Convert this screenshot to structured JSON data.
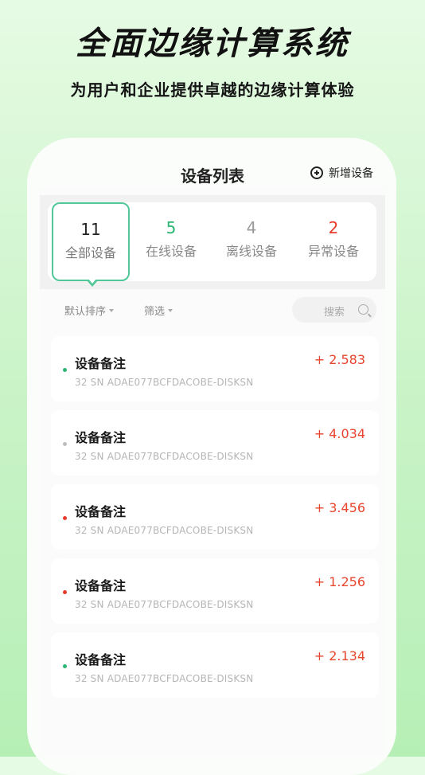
{
  "promo": {
    "title": "全面边缘计算系统",
    "subtitle": "为用户和企业提供卓越的边缘计算体验"
  },
  "topbar": {
    "title": "设备列表",
    "add_label": "新增设备"
  },
  "stats": [
    {
      "count": "11",
      "label": "全部设备",
      "color": "#222222",
      "active": true
    },
    {
      "count": "5",
      "label": "在线设备",
      "color": "#2bb673",
      "active": false
    },
    {
      "count": "4",
      "label": "离线设备",
      "color": "#9a9a9a",
      "active": false
    },
    {
      "count": "2",
      "label": "异常设备",
      "color": "#e83b2c",
      "active": false
    }
  ],
  "filters": {
    "sort_label": "默认排序",
    "filter_label": "筛选",
    "search_placeholder": "搜索"
  },
  "devices": [
    {
      "name": "设备备注",
      "sn": "32 SN ADAE077BCFDACOBE-DISKSN",
      "value": "+ 2.583",
      "status_color": "#2bb673"
    },
    {
      "name": "设备备注",
      "sn": "32 SN ADAE077BCFDACOBE-DISKSN",
      "value": "+ 4.034",
      "status_color": "#bdbdbd"
    },
    {
      "name": "设备备注",
      "sn": "32 SN ADAE077BCFDACOBE-DISKSN",
      "value": "+ 3.456",
      "status_color": "#e83b2c"
    },
    {
      "name": "设备备注",
      "sn": "32 SN ADAE077BCFDACOBE-DISKSN",
      "value": "+ 1.256",
      "status_color": "#e83b2c"
    },
    {
      "name": "设备备注",
      "sn": "32 SN ADAE077BCFDACOBE-DISKSN",
      "value": "+ 2.134",
      "status_color": "#2bb673"
    }
  ]
}
